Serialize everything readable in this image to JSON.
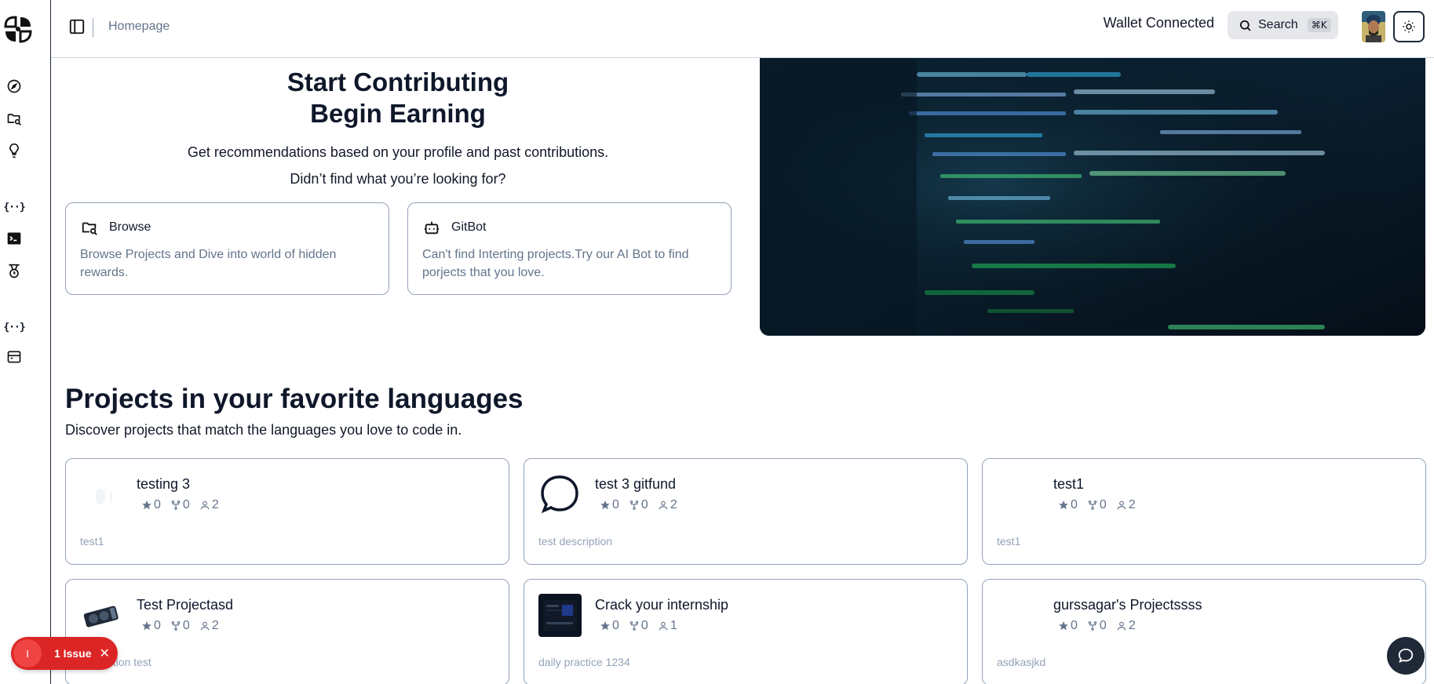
{
  "header": {
    "breadcrumb": "Homepage",
    "wallet_status": "Wallet Connected",
    "search_label": "Search",
    "search_shortcut": "⌘K"
  },
  "sidebar": {
    "icons": [
      "logo-icon",
      "compass-icon",
      "folder-search-icon",
      "lightbulb-icon",
      "braces-icon",
      "terminal-icon",
      "medal-icon",
      "braces-icon",
      "archive-icon"
    ]
  },
  "hero": {
    "title_line1": "Start Contributing",
    "title_line2": "Begin Earning",
    "subtitle": "Get recommendations based on your profile and past contributions.",
    "subtitle2": "Didn’t find what you’re looking for?",
    "cards": [
      {
        "title": "Browse",
        "description": "Browse Projects and Dive into world of hidden rewards."
      },
      {
        "title": "GitBot",
        "description": "Can't find Interting projects.Try our AI Bot to find porjects that you love."
      }
    ]
  },
  "section": {
    "title": "Projects in your favorite languages",
    "subtitle": "Discover projects that match the languages you love to code in."
  },
  "projects": [
    {
      "name": "testing 3",
      "stars": "0",
      "forks": "0",
      "contributors": "2",
      "description": "test1"
    },
    {
      "name": "test 3 gitfund",
      "stars": "0",
      "forks": "0",
      "contributors": "2",
      "description": "test description"
    },
    {
      "name": "test1",
      "stars": "0",
      "forks": "0",
      "contributors": "2",
      "description": "test1"
    },
    {
      "name": "Test Projectasd",
      "stars": "0",
      "forks": "0",
      "contributors": "2",
      "description": "ption test"
    },
    {
      "name": "Crack your internship",
      "stars": "0",
      "forks": "0",
      "contributors": "1",
      "description": "daily practice 1234"
    },
    {
      "name": "gurssagar's Projectssss",
      "stars": "0",
      "forks": "0",
      "contributors": "2",
      "description": "asdkasjkd"
    }
  ],
  "issue_badge": {
    "icon_text": "I",
    "label": "1 Issue",
    "close": "✕"
  },
  "colors": {
    "accent_red": "#dc2626",
    "text_dark": "#0f172a",
    "text_muted": "#64748b",
    "border": "#94a3b8",
    "code_green": "#4ade80"
  }
}
